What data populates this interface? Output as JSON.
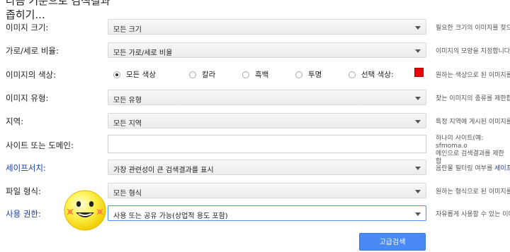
{
  "header": {
    "title": "다음 기준으로 검색결과 좁히기..."
  },
  "rows": {
    "size": {
      "label": "이미지 크기:",
      "value": "모든 크기",
      "hint": "필요한 크기의 이미지를 찾으"
    },
    "aspect": {
      "label": "가로/세로 비율:",
      "value": "모든 가로/세로 비율",
      "hint": "이미지의 모양을 지정합니다"
    },
    "color": {
      "label": "이미지의 색상:",
      "options": [
        "모든 색상",
        "칼라",
        "흑백",
        "투명",
        "선택 색상:"
      ],
      "selected": "모든 색상",
      "swatch_color": "#e8060a",
      "hint": "원하는 색상으로 된 이미지를"
    },
    "type": {
      "label": "이미지 유형:",
      "value": "모든 유형",
      "hint": "찾는 이미지의 종류를 제한합"
    },
    "region": {
      "label": "지역:",
      "value": "모든 지역",
      "hint": "특정 지역에 게시된 이미지를"
    },
    "site": {
      "label": "사이트 또는 도메인:",
      "value": "",
      "hint_line1": "하나의 사이트(예: sfmoma.o",
      "hint_line2": "메인으로 검색결과를 제한합"
    },
    "safesearch": {
      "label": "세이프서치:",
      "value": "가장 관련성이 큰 검색결과를 표시",
      "hint_prefix": "음란물 필터링 여부를 ",
      "hint_link": "세이프"
    },
    "filetype": {
      "label": "파일 형식:",
      "value": "모든 형식",
      "hint": "원하는 형식으로 된 이미지를"
    },
    "rights": {
      "label": "사용 권한:",
      "value": "사용 또는 공유 가능(상업적 용도 포함)",
      "hint": "자유롭게 사용할 수 있는 이미"
    }
  },
  "submit": {
    "label": "고급검색"
  },
  "colors": {
    "link": "#1a3aa8",
    "button": "#4a8af4",
    "swatch": "#e8060a"
  },
  "icons": {
    "sticker": "smiling-face-sticker",
    "dropdown": "caret-down-icon"
  }
}
